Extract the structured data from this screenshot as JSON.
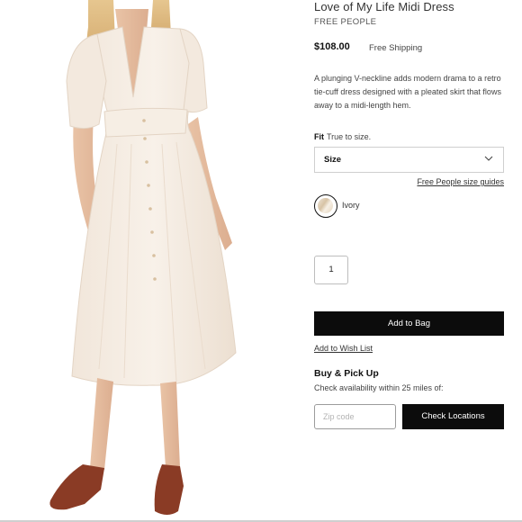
{
  "product": {
    "title": "Love of My Life Midi Dress",
    "brand": "FREE PEOPLE",
    "price": "$108.00",
    "shipping": "Free Shipping",
    "description": "A plunging V-neckline adds modern drama to a retro tie-cuff dress designed with a pleated skirt that flows away to a midi-length hem."
  },
  "fit": {
    "label": "Fit",
    "note": "True to size."
  },
  "size_select": {
    "label": "Size"
  },
  "size_guide_label": "Free People size guides",
  "color": {
    "name": "Ivory",
    "swatch_color": "#e8dcc8"
  },
  "quantity": {
    "value": "1"
  },
  "actions": {
    "add_to_bag": "Add to Bag",
    "add_to_wish_list": "Add to Wish List"
  },
  "pickup": {
    "title": "Buy & Pick Up",
    "subtitle": "Check availability within 25 miles of:",
    "zip_placeholder": "Zip code",
    "check_button": "Check Locations"
  },
  "colors": {
    "button_bg": "#0c0c0c",
    "dress": "#f4ebe1",
    "shoes": "#8a3b25"
  }
}
